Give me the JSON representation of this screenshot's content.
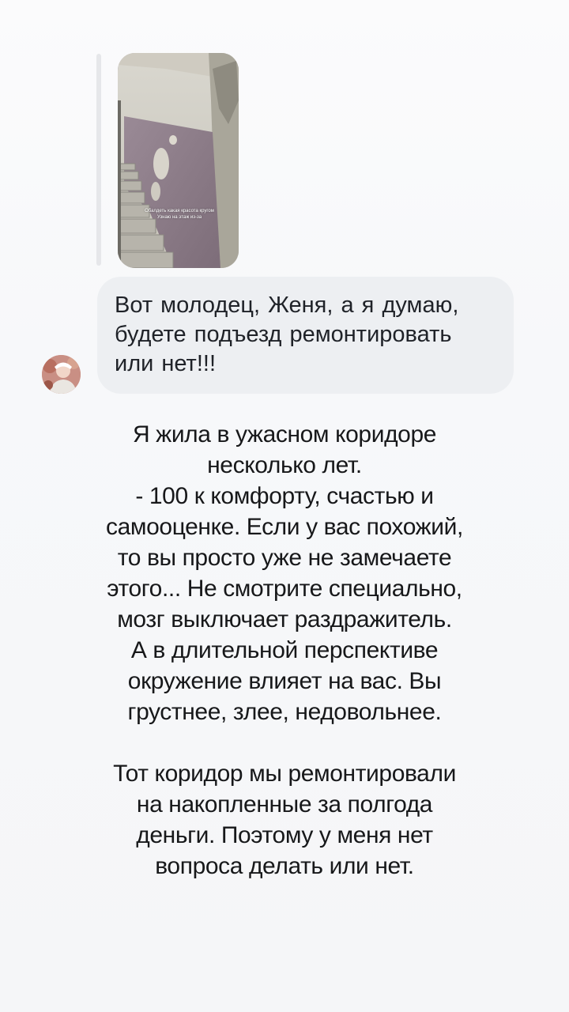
{
  "story": {
    "reply_thumbnail": {
      "caption_line1": "Обалдеть какая красота кругом",
      "caption_line2": "Узнаю на этаж из-за"
    },
    "comment": {
      "text": "Вот молодец, Женя, а я думаю,\nбудете  подъезд  ремонтировать\nили нет!!!"
    },
    "body": {
      "paragraph1": "Я жила в ужасном коридоре\nнесколько лет.\n- 100 к комфорту, счастью и\nсамооценке. Если у вас похожий,\nто вы просто уже не замечаете\nэтого... Не смотрите специально,\nмозг выключает раздражитель.\nА в длительной перспективе\nокружение влияет на вас. Вы\nгрустнее, злее, недовольнее.",
      "paragraph2": "Тот коридор мы ремонтировали\nна накопленные за полгода\nденьги. Поэтому у меня нет\nвопроса делать или нет."
    }
  },
  "icons": {
    "avatar": "user-avatar-photo"
  },
  "colors": {
    "background": "#f6f7f9",
    "bubble": "#edeff2",
    "text": "#17181a",
    "wall_purple": "#8b7c86"
  }
}
